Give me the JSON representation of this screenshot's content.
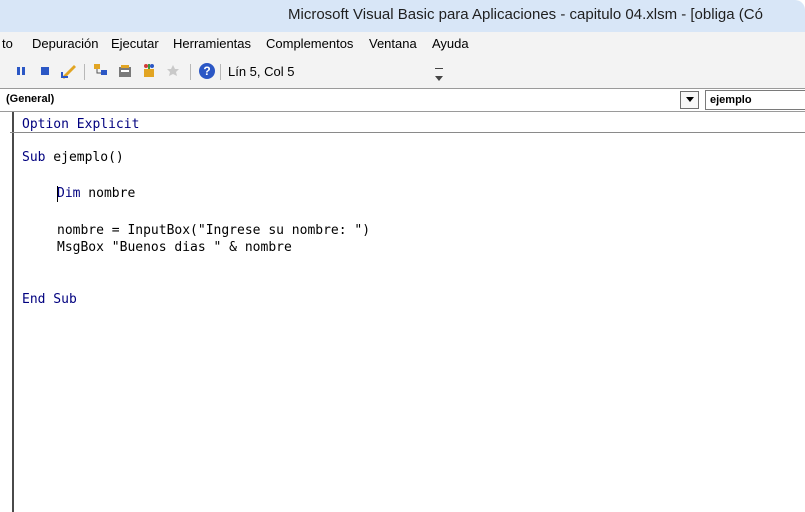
{
  "window": {
    "title": "Microsoft Visual Basic para Aplicaciones - capitulo 04.xlsm - [obliga (Có"
  },
  "menu": {
    "items": [
      {
        "label": "to"
      },
      {
        "label": "Depuración"
      },
      {
        "label": "Ejecutar"
      },
      {
        "label": "Herramientas"
      },
      {
        "label": "Complementos"
      },
      {
        "label": "Ventana"
      },
      {
        "label": "Ayuda"
      }
    ]
  },
  "toolbar": {
    "position_text": "Lín 5, Col 5"
  },
  "procedure_bar": {
    "object": "(General)",
    "procedure": "ejemplo"
  },
  "code": {
    "lines": [
      {
        "kw": "Option Explicit",
        "rest": ""
      },
      {
        "kw": "Sub",
        "rest": " ejemplo()"
      },
      {
        "kw": "Dim",
        "rest": " nombre"
      },
      {
        "kw": "",
        "rest": "nombre = InputBox(\"Ingrese su nombre: \")"
      },
      {
        "kw": "",
        "rest": "MsgBox \"Buenos dias \" & nombre"
      },
      {
        "kw": "End Sub",
        "rest": ""
      }
    ]
  },
  "colors": {
    "keyword": "#00007f",
    "title_bar": "#d8e6f7",
    "chrome": "#f3f3f3"
  }
}
